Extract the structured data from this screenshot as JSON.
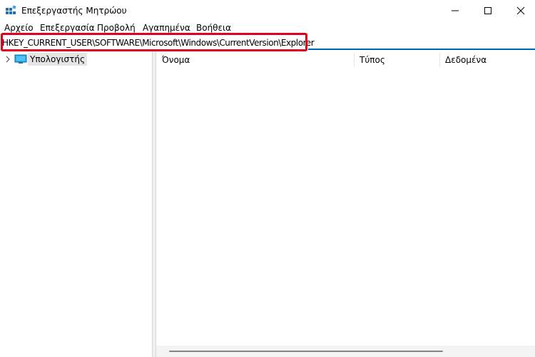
{
  "window": {
    "title": "Επεξεργαστής Μητρώου",
    "icon": "registry-editor-icon",
    "controls": [
      "minimize-icon",
      "maximize-icon",
      "close-icon"
    ]
  },
  "menu": {
    "items": [
      "Αρχείο",
      "Επεξεργασία",
      "Προβολή",
      "Αγαπημένα",
      "Βοήθεια"
    ]
  },
  "address": {
    "value": "HKEY_CURRENT_USER\\SOFTWARE\\Microsoft\\Windows\\CurrentVersion\\Explorer",
    "highlight_color": "#e0001a"
  },
  "tree": {
    "root": {
      "label": "Υπολογιστής",
      "icon": "computer-icon",
      "expander": "chevron-right-icon"
    }
  },
  "list": {
    "columns": [
      "Όνομα",
      "Τύπος",
      "Δεδομένα"
    ]
  },
  "colors": {
    "accent": "#0063b1",
    "highlight": "#e0001a",
    "selection": "#e5e5e5"
  }
}
